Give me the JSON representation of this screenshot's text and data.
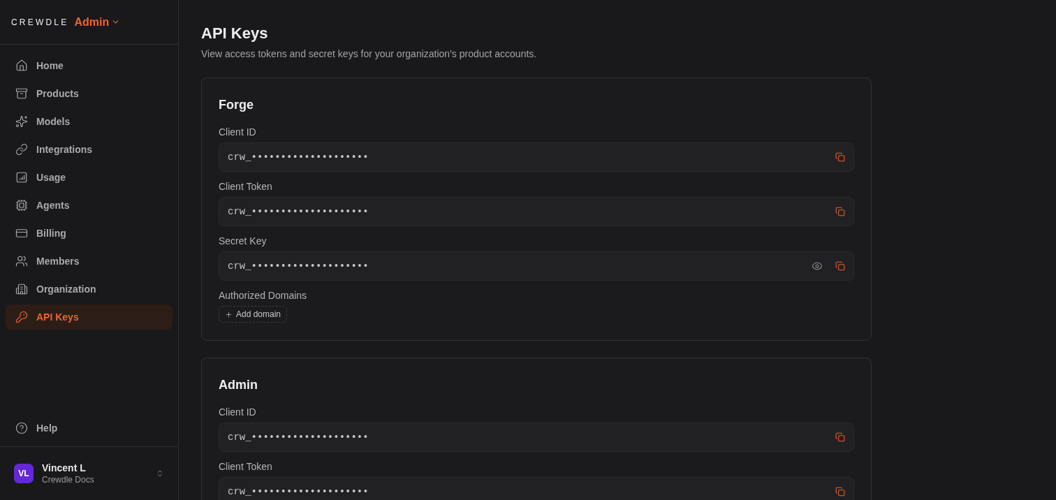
{
  "brand": {
    "logo": "CREWDLE",
    "workspace": "Admin"
  },
  "sidebar": {
    "items": [
      {
        "label": "Home",
        "selected": false
      },
      {
        "label": "Products",
        "selected": false
      },
      {
        "label": "Models",
        "selected": false
      },
      {
        "label": "Integrations",
        "selected": false
      },
      {
        "label": "Usage",
        "selected": false
      },
      {
        "label": "Agents",
        "selected": false
      },
      {
        "label": "Billing",
        "selected": false
      },
      {
        "label": "Members",
        "selected": false
      },
      {
        "label": "Organization",
        "selected": false
      },
      {
        "label": "API Keys",
        "selected": true
      }
    ],
    "help": "Help",
    "user": {
      "initials": "VL",
      "name": "Vincent L",
      "org": "Crewdle Docs"
    }
  },
  "page": {
    "title": "API Keys",
    "subtitle": "View access tokens and secret keys for your organization's product accounts."
  },
  "accounts": [
    {
      "name": "Forge",
      "fields": [
        {
          "label": "Client ID",
          "value": "crw_••••••••••••••••••••",
          "reveal_toggle": false
        },
        {
          "label": "Client Token",
          "value": "crw_••••••••••••••••••••",
          "reveal_toggle": false
        },
        {
          "label": "Secret Key",
          "value": "crw_••••••••••••••••••••",
          "reveal_toggle": true
        }
      ],
      "authorized_domains": {
        "label": "Authorized Domains",
        "button": "Add domain"
      }
    },
    {
      "name": "Admin",
      "fields": [
        {
          "label": "Client ID",
          "value": "crw_••••••••••••••••••••",
          "reveal_toggle": false
        },
        {
          "label": "Client Token",
          "value": "crw_••••••••••••••••••••",
          "reveal_toggle": false
        }
      ]
    }
  ]
}
